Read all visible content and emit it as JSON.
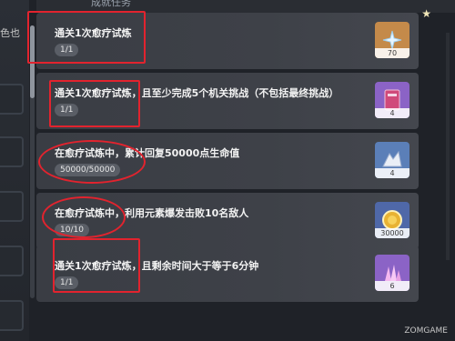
{
  "sidebar": {
    "text": "色也"
  },
  "header": {
    "title": "成就任务"
  },
  "tasks": [
    {
      "title": "通关1次愈疗试炼",
      "progress": "1/1",
      "reward": {
        "icon": "primogem-star-icon",
        "count": "70",
        "bg": "#c48a4a"
      }
    },
    {
      "title": "通关1次愈疗试炼，且至少完成5个机关挑战（不包括最终挑战）",
      "progress": "1/1",
      "reward": {
        "icon": "book-icon",
        "count": "4",
        "bg": "#8b63c6"
      }
    },
    {
      "title": "在愈疗试炼中，累计回复50000点生命值",
      "progress": "50000/50000",
      "reward": {
        "icon": "hero-wit-icon",
        "count": "4",
        "bg": "#5b7fb8"
      }
    },
    {
      "title": "在愈疗试炼中，利用元素爆发击败10名敌人",
      "progress": "10/10",
      "reward": {
        "icon": "mora-icon",
        "count": "30000",
        "bg": "#4f68a8"
      }
    },
    {
      "title": "通关1次愈疗试炼，且剩余时间大于等于6分钟",
      "progress": "1/1",
      "reward": {
        "icon": "crystal-icon",
        "count": "6",
        "bg": "#8b63c6"
      }
    }
  ],
  "watermark": "ZOMGAME"
}
